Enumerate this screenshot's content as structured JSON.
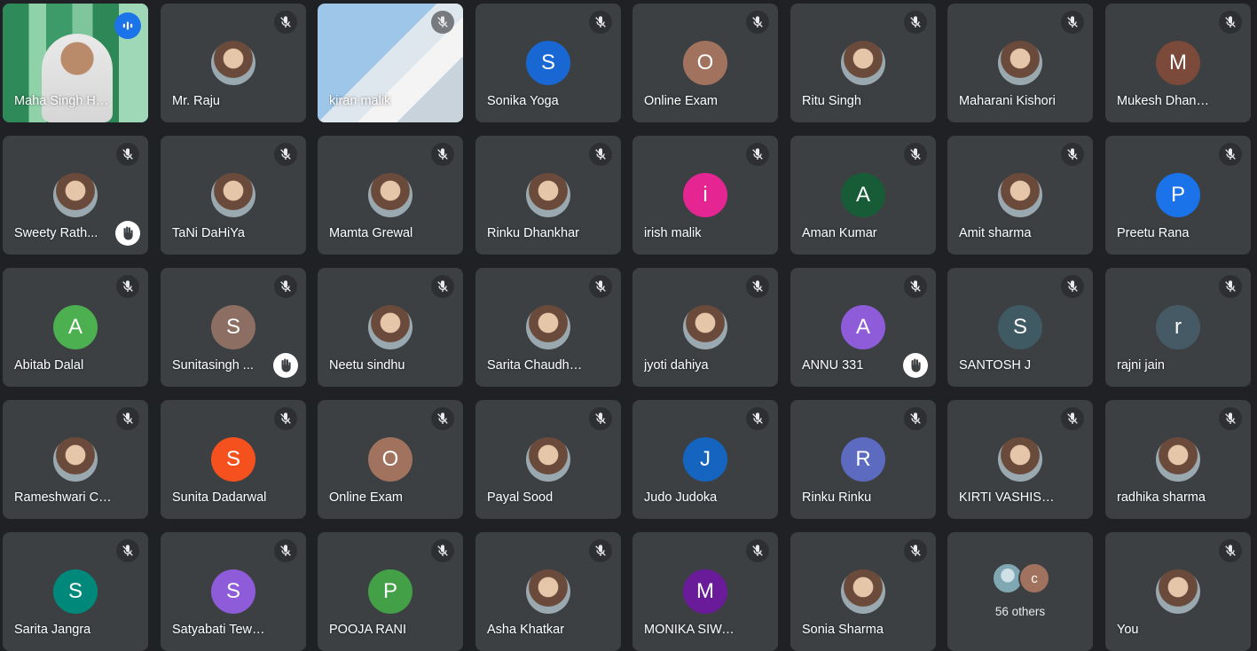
{
  "colors": {
    "tile_bg": "#3c4043",
    "page_bg": "#202124",
    "speaking_accent": "#1a73e8"
  },
  "tiles": [
    {
      "name": "Maha Singh Hoo...",
      "type": "video",
      "speaking": true
    },
    {
      "name": "Mr. Raju",
      "type": "photo",
      "muted": true
    },
    {
      "name": "kiran malik",
      "type": "video2",
      "muted": true
    },
    {
      "name": "Sonika Yoga",
      "type": "letter",
      "letter": "S",
      "color": "#1967d2",
      "muted": true
    },
    {
      "name": "Online Exam",
      "type": "letter",
      "letter": "O",
      "color": "#a1735f",
      "muted": true
    },
    {
      "name": "Ritu Singh",
      "type": "photo",
      "muted": true
    },
    {
      "name": "Maharani Kishori",
      "type": "photo",
      "muted": true
    },
    {
      "name": "Mukesh Dhankhar",
      "type": "letter",
      "letter": "M",
      "color": "#7b4a3a",
      "muted": true
    },
    {
      "name": "Sweety Rath...",
      "type": "photo",
      "muted": true,
      "hand": true
    },
    {
      "name": "TaNi DaHiYa",
      "type": "photo",
      "muted": true
    },
    {
      "name": "Mamta Grewal",
      "type": "photo",
      "muted": true
    },
    {
      "name": "Rinku Dhankhar",
      "type": "photo",
      "muted": true
    },
    {
      "name": "irish malik",
      "type": "letter",
      "letter": "i",
      "color": "#e52592",
      "muted": true
    },
    {
      "name": "Aman Kumar",
      "type": "letter",
      "letter": "A",
      "color": "#185c37",
      "muted": true
    },
    {
      "name": "Amit sharma",
      "type": "photo",
      "muted": true
    },
    {
      "name": "Preetu Rana",
      "type": "letter",
      "letter": "P",
      "color": "#1a73e8",
      "muted": true
    },
    {
      "name": "Abitab Dalal",
      "type": "letter",
      "letter": "A",
      "color": "#4caf50",
      "muted": true
    },
    {
      "name": "Sunitasingh ...",
      "type": "letter",
      "letter": "S",
      "color": "#8d6e63",
      "muted": true,
      "hand": true
    },
    {
      "name": "Neetu sindhu",
      "type": "photo",
      "muted": true
    },
    {
      "name": "Sarita Chaudhary",
      "type": "photo",
      "muted": true
    },
    {
      "name": "jyoti dahiya",
      "type": "photo",
      "muted": true
    },
    {
      "name": "ANNU 331",
      "type": "letter",
      "letter": "A",
      "color": "#8e5cd9",
      "muted": true,
      "hand": true
    },
    {
      "name": "SANTOSH J",
      "type": "letter",
      "letter": "S",
      "color": "#3f5a63",
      "muted": true
    },
    {
      "name": "rajni jain",
      "type": "letter",
      "letter": "r",
      "color": "#455a64",
      "muted": true
    },
    {
      "name": "Rameshwari Cha...",
      "type": "photo",
      "muted": true
    },
    {
      "name": "Sunita Dadarwal",
      "type": "letter",
      "letter": "S",
      "color": "#f4511e",
      "muted": true
    },
    {
      "name": "Online Exam",
      "type": "letter",
      "letter": "O",
      "color": "#a1735f",
      "muted": true
    },
    {
      "name": "Payal Sood",
      "type": "photo",
      "muted": true
    },
    {
      "name": "Judo Judoka",
      "type": "letter",
      "letter": "J",
      "color": "#1565c0",
      "muted": true
    },
    {
      "name": "Rinku Rinku",
      "type": "letter",
      "letter": "R",
      "color": "#5c6bc0",
      "muted": true
    },
    {
      "name": "KIRTI VASHISHT",
      "type": "photo",
      "muted": true
    },
    {
      "name": "radhika sharma",
      "type": "photo",
      "muted": true
    },
    {
      "name": "Sarita Jangra",
      "type": "letter",
      "letter": "S",
      "color": "#00897b",
      "muted": true
    },
    {
      "name": "Satyabati Tewatia",
      "type": "letter",
      "letter": "S",
      "color": "#8e5cd9",
      "muted": true
    },
    {
      "name": "POOJA RANI",
      "type": "letter",
      "letter": "P",
      "color": "#43a047",
      "muted": true
    },
    {
      "name": "Asha Khatkar",
      "type": "photo",
      "muted": true
    },
    {
      "name": "MONIKA SIWACH",
      "type": "letter",
      "letter": "M",
      "color": "#6a1b9a",
      "muted": true
    },
    {
      "name": "Sonia Sharma",
      "type": "photo",
      "muted": true
    },
    {
      "name": "56 others",
      "type": "others",
      "letter": "c",
      "color": "#a1735f"
    },
    {
      "name": "You",
      "type": "photo",
      "muted": true
    }
  ]
}
